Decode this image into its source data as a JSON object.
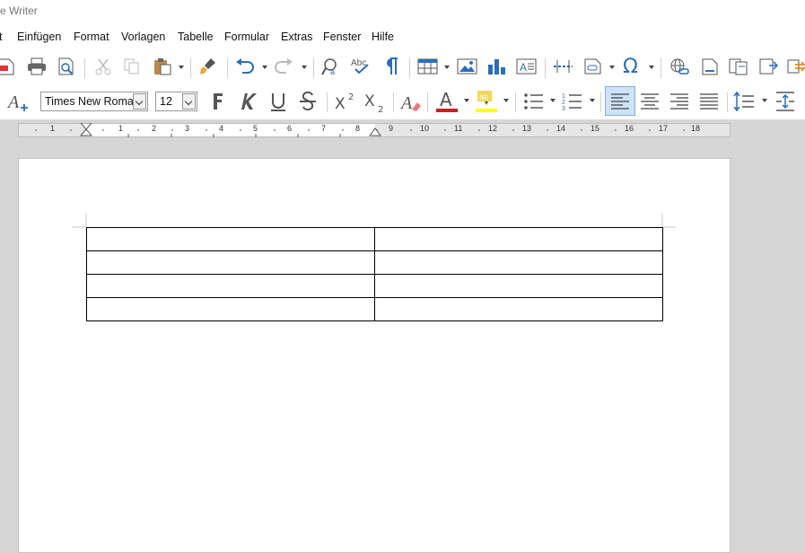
{
  "window": {
    "title": "e Writer"
  },
  "menu": [
    "t",
    "Einfügen",
    "Format",
    "Vorlagen",
    "Tabelle",
    "Formular",
    "Extras",
    "Fenster",
    "Hilfe"
  ],
  "formatting": {
    "font_name": "Times New Roman",
    "font_size": "12"
  },
  "ruler": {
    "numbers": [
      "1",
      "1",
      "2",
      "3",
      "4",
      "5",
      "6",
      "7",
      "8",
      "9",
      "10",
      "11",
      "12",
      "13",
      "14",
      "15",
      "16",
      "17",
      "18"
    ]
  },
  "table": {
    "rows": 4,
    "cols": 2
  },
  "colors": {
    "font_color": "#c9211e",
    "highlight_color": "#ffff00",
    "accent": "#2a6ebb"
  }
}
